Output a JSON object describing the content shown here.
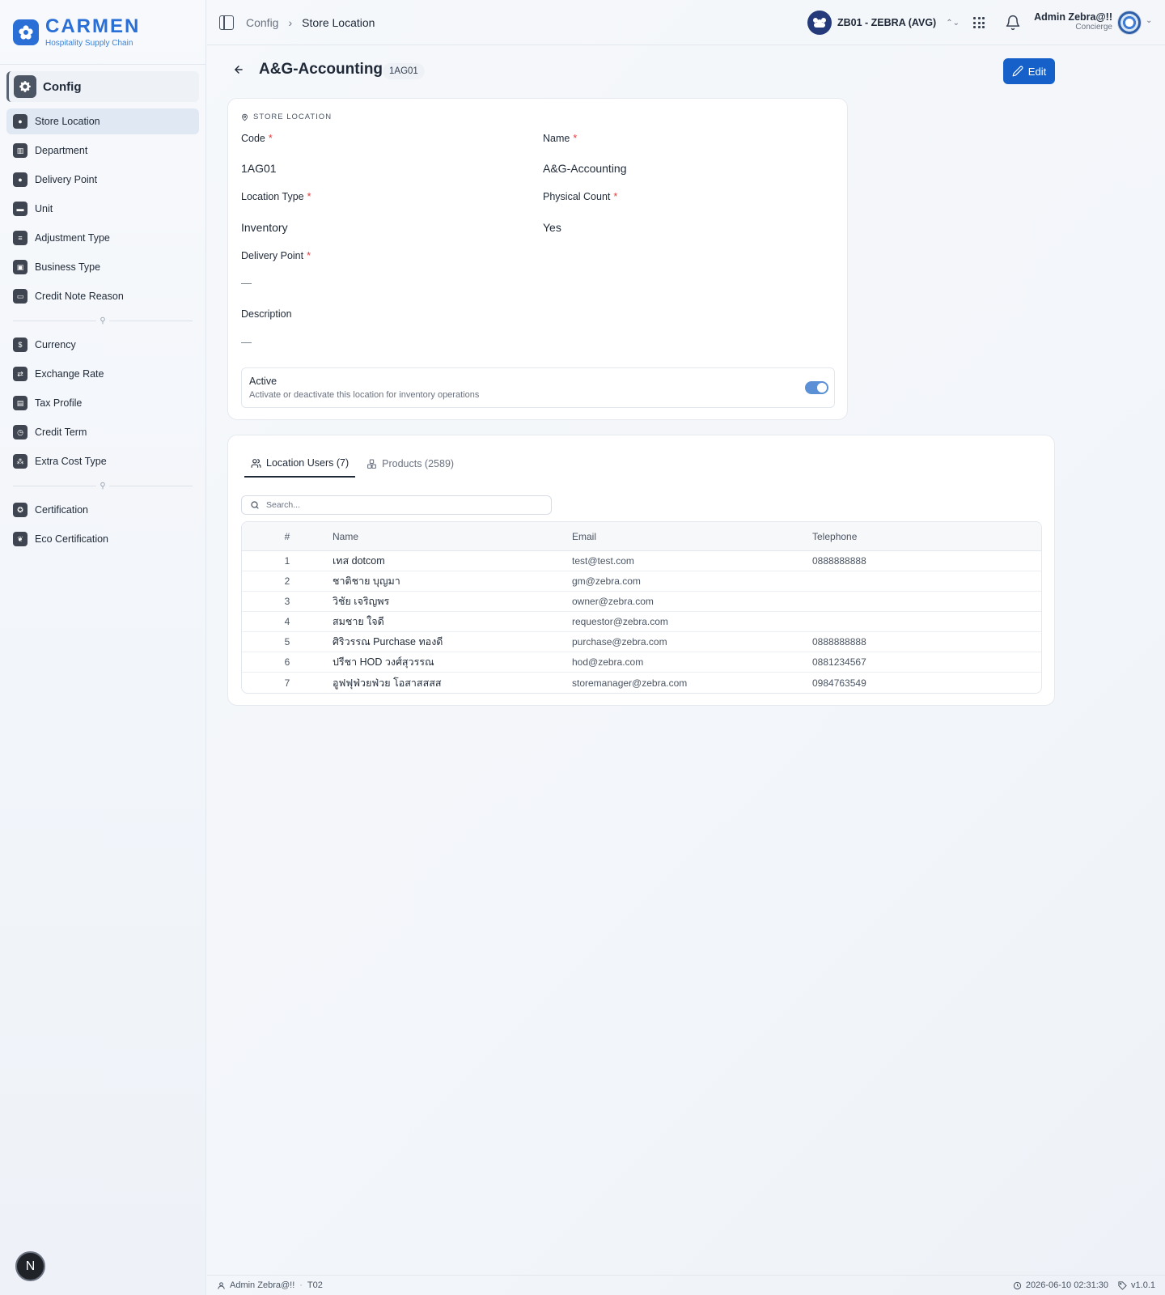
{
  "brand": {
    "name": "CARMEN",
    "tagline": "Hospitality Supply Chain"
  },
  "sidebar": {
    "section": "Config",
    "groups": [
      [
        {
          "label": "Store Location",
          "icon": "map-pin-icon",
          "active": true
        },
        {
          "label": "Department",
          "icon": "building-icon"
        },
        {
          "label": "Delivery Point",
          "icon": "map-pin-icon"
        },
        {
          "label": "Unit",
          "icon": "ruler-icon"
        },
        {
          "label": "Adjustment Type",
          "icon": "sliders-icon"
        },
        {
          "label": "Business Type",
          "icon": "briefcase-icon"
        },
        {
          "label": "Credit Note Reason",
          "icon": "message-icon"
        }
      ],
      [
        {
          "label": "Currency",
          "icon": "coin-icon"
        },
        {
          "label": "Exchange Rate",
          "icon": "exchange-icon"
        },
        {
          "label": "Tax Profile",
          "icon": "file-icon"
        },
        {
          "label": "Credit Term",
          "icon": "clock-icon"
        },
        {
          "label": "Extra Cost Type",
          "icon": "cost-icon"
        }
      ],
      [
        {
          "label": "Certification",
          "icon": "award-icon"
        },
        {
          "label": "Eco Certification",
          "icon": "leaf-icon"
        }
      ]
    ]
  },
  "topbar": {
    "breadcrumb": [
      "Config",
      "Store Location"
    ],
    "business_unit": "ZB01 - ZEBRA (AVG)",
    "user_name": "Admin Zebra@!!",
    "user_role": "Concierge"
  },
  "page": {
    "title": "A&G-Accounting",
    "code": "1AG01",
    "edit_label": "Edit"
  },
  "details": {
    "kicker": "STORE LOCATION",
    "code_label": "Code",
    "code_value": "1AG01",
    "name_label": "Name",
    "name_value": "A&G-Accounting",
    "location_type_label": "Location Type",
    "location_type_value": "Inventory",
    "physical_count_label": "Physical Count",
    "physical_count_value": "Yes",
    "delivery_point_label": "Delivery Point",
    "delivery_point_value": "—",
    "description_label": "Description",
    "description_value": "—",
    "active_title": "Active",
    "active_desc": "Activate or deactivate this location for inventory operations",
    "active_on": true
  },
  "tabs": [
    {
      "label": "Location Users (7)",
      "icon": "users-icon",
      "active": true
    },
    {
      "label": "Products (2589)",
      "icon": "boxes-icon"
    }
  ],
  "search": {
    "placeholder": "Search..."
  },
  "table": {
    "headers": [
      "#",
      "Name",
      "Email",
      "Telephone"
    ],
    "rows": [
      [
        "1",
        "เทส dotcom",
        "test@test.com",
        "0888888888"
      ],
      [
        "2",
        "ชาติชาย บุญมา",
        "gm@zebra.com",
        ""
      ],
      [
        "3",
        "วิชัย เจริญพร",
        "owner@zebra.com",
        ""
      ],
      [
        "4",
        "สมชาย ใจดี",
        "requestor@zebra.com",
        ""
      ],
      [
        "5",
        "ศิริวรรณ Purchase ทองดี",
        "purchase@zebra.com",
        "0888888888"
      ],
      [
        "6",
        "ปรีชา HOD วงศ์สุวรรณ",
        "hod@zebra.com",
        "0881234567"
      ],
      [
        "7",
        "อูฟฟุฟ่วยฟ่วย โอสาสสสส",
        "storemanager@zebra.com",
        "0984763549"
      ]
    ]
  },
  "footer": {
    "user": "Admin Zebra@!!",
    "tenant": "T02",
    "datetime": "2026-06-10 02:31:30",
    "version": "v1.0.1"
  },
  "badge": "N",
  "colors": {
    "accent": "#1560c9",
    "brand": "#2a6fd6",
    "required": "#e23b3b",
    "switch_on": "#5b8fd6"
  }
}
